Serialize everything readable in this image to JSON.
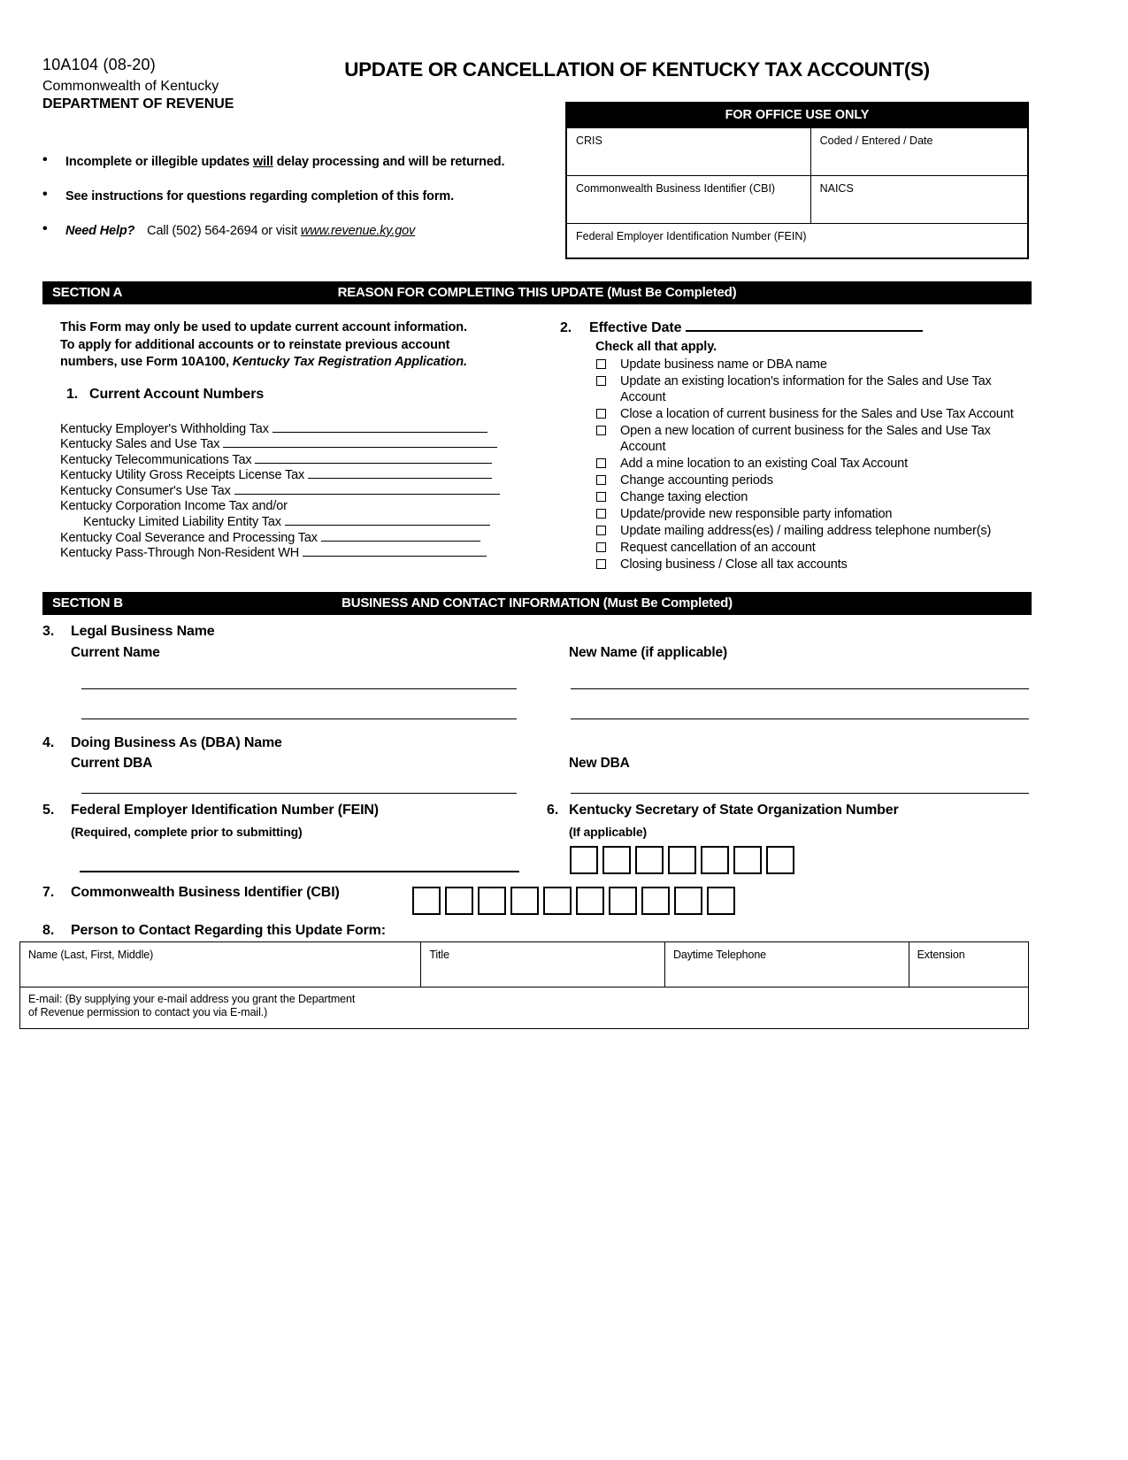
{
  "header": {
    "form_number": "10A104 (08-20)",
    "commonwealth": "Commonwealth of Kentucky",
    "department": "DEPARTMENT OF REVENUE",
    "title": "UPDATE OR CANCELLATION OF KENTUCKY TAX ACCOUNT(S)"
  },
  "bullets": {
    "b1_pre": "Incomplete or illegible updates ",
    "b1_underline": "will",
    "b1_post": " delay processing and will be returned.",
    "b2": "See instructions for questions regarding completion of this form.",
    "b3_bold_italic": "Need Help?",
    "b3_plain": "Call (502) 564-2694 or visit ",
    "b3_link": "www.revenue.ky.gov"
  },
  "office_use": {
    "title": "FOR OFFICE USE ONLY",
    "cris": "CRIS",
    "coded_entered_date": "Coded / Entered / Date",
    "cbi": "Commonwealth Business Identifier (CBI)",
    "naics": "NAICS",
    "fein": "Federal Employer Identification Number (FEIN)"
  },
  "section_a": {
    "label": "SECTION A",
    "title": "REASON FOR COMPLETING THIS UPDATE (Must Be Completed)",
    "intro_line1": "This Form may only be used to update current account information.",
    "intro_line2": "To apply for additional accounts or to reinstate previous account",
    "intro_line3_pre": "numbers, use Form 10A100, ",
    "intro_line3_italic": "Kentucky Tax Registration Application.",
    "item1_number": "1.",
    "item1_label": "Current Account Numbers",
    "accounts": [
      {
        "label": "Kentucky Employer's Withholding Tax",
        "rule_width": 243,
        "indent": false
      },
      {
        "label": "Kentucky Sales and Use Tax",
        "rule_width": 310,
        "indent": false
      },
      {
        "label": "Kentucky Telecommunications Tax",
        "rule_width": 268,
        "indent": false
      },
      {
        "label": "Kentucky Utility Gross Receipts License Tax",
        "rule_width": 208,
        "indent": false
      },
      {
        "label": "Kentucky Consumer's Use Tax",
        "rule_width": 300,
        "indent": false
      },
      {
        "label": "Kentucky Corporation Income Tax and/or",
        "rule_width": 0,
        "indent": false
      },
      {
        "label": "Kentucky Limited Liability Entity Tax",
        "rule_width": 232,
        "indent": true
      },
      {
        "label": "Kentucky Coal Severance and Processing Tax",
        "rule_width": 180,
        "indent": false
      },
      {
        "label": "Kentucky Pass-Through Non-Resident WH",
        "rule_width": 208,
        "indent": false
      }
    ],
    "item2_number": "2.",
    "item2_label": "Effective Date",
    "check_all_that_apply": "Check all that apply.",
    "checkboxes": [
      "Update business name or DBA name",
      "Update an existing location's information for the Sales and Use Tax Account",
      "Close a location of current business for the Sales and Use Tax Account",
      "Open a new location of current business for the Sales and Use Tax Account",
      "Add a mine location to an existing Coal Tax Account",
      "Change accounting periods",
      "Change taxing election",
      "Update/provide new responsible party infomation",
      "Update mailing address(es) / mailing address telephone number(s)",
      "Request cancellation of an account",
      "Closing business / Close all tax accounts"
    ]
  },
  "section_b": {
    "label": "SECTION B",
    "title": "BUSINESS AND CONTACT INFORMATION (Must Be Completed)",
    "item3_number": "3.",
    "item3_label": "Legal Business Name",
    "item3_current": "Current Name",
    "item3_new": "New Name (if applicable)",
    "item4_number": "4.",
    "item4_label": "Doing Business As (DBA) Name",
    "item4_current": "Current DBA",
    "item4_new": "New DBA",
    "item5_number": "5.",
    "item5_label": "Federal Employer Identification Number (FEIN)",
    "item5_note": "(Required, complete prior to submitting)",
    "item6_number": "6.",
    "item6_label": "Kentucky Secretary of State Organization Number",
    "item6_note": "(If applicable)",
    "item6_box_count": 7,
    "item7_number": "7.",
    "item7_label": "Commonwealth Business Identifier (CBI)",
    "item7_box_count": 10,
    "item8_number": "8.",
    "item8_label": "Person to Contact Regarding this Update Form:",
    "contact_headers": {
      "name": "Name (Last, First, Middle)",
      "title": "Title",
      "phone": "Daytime Telephone",
      "extension": "Extension"
    },
    "email_note_line1": "E-mail: (By supplying your e-mail address you grant the Department",
    "email_note_line2": "of Revenue permission to contact you via E-mail.)"
  }
}
